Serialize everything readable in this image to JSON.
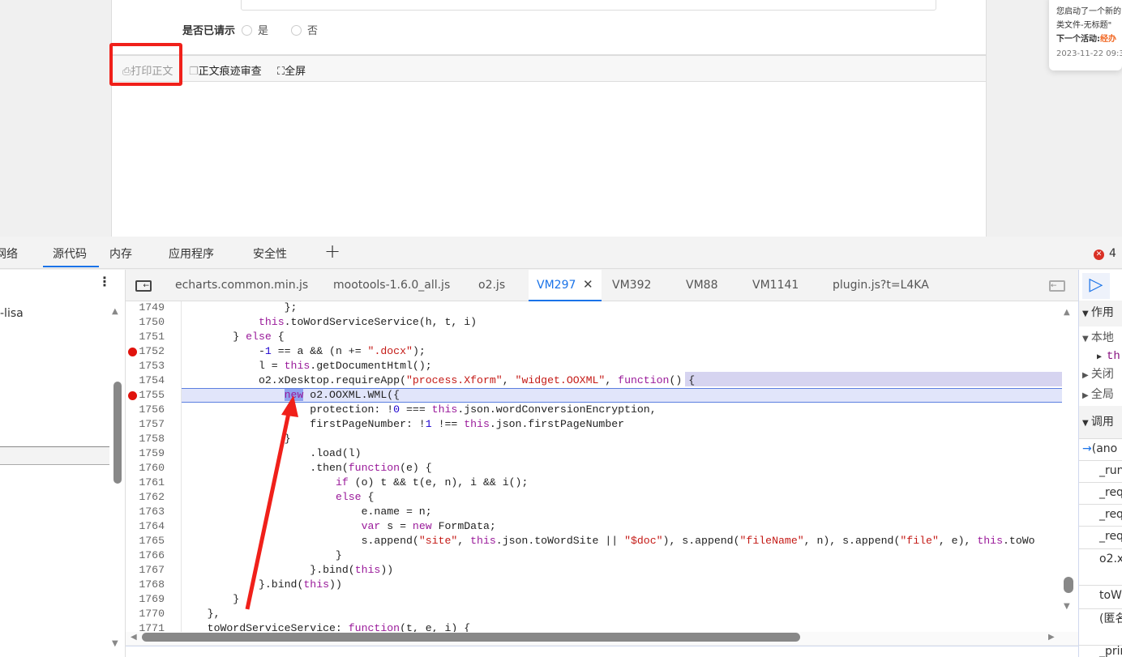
{
  "form": {
    "label": "是否已请示",
    "options": [
      "是",
      "否"
    ]
  },
  "toolbar": {
    "print": "打印正文",
    "revision": "正文痕迹审查",
    "fullscreen": "全屏"
  },
  "notification": {
    "line1": "您启动了一个新的",
    "line2": "类文件-无标题\"",
    "next_label": "下一个活动:",
    "next_value": "经办",
    "time": "2023-11-22 09:3"
  },
  "devtools": {
    "tabs": [
      "网络",
      "源代码",
      "内存",
      "应用程序",
      "安全性"
    ],
    "active_tab": "源代码",
    "add_tab": "+",
    "error_count": "4",
    "navigator_item": "-lisa",
    "file_tabs": [
      "echarts.common.min.js",
      "mootools-1.6.0_all.js",
      "o2.js",
      "VM297",
      "VM392",
      "VM88",
      "VM1141",
      "plugin.js?t=L4KA"
    ],
    "active_file": "VM297",
    "right_panel": {
      "scope": "作用",
      "local": "本地",
      "this": "th",
      "closure": "关闭",
      "global": "全局",
      "callstack": "调用",
      "frames": [
        "(ano",
        "_run",
        "_req",
        "_req",
        "_req",
        "o2.xl",
        "toWo",
        "(匿名",
        "_prin"
      ]
    }
  },
  "code": {
    "lines": [
      {
        "no": "1749",
        "t": [
          [
            "p",
            "                };"
          ]
        ]
      },
      {
        "no": "1750",
        "t": [
          [
            "p",
            "            "
          ],
          [
            "k",
            "this"
          ],
          [
            "p",
            ".toWordServiceService(h, t, i)"
          ]
        ]
      },
      {
        "no": "1751",
        "t": [
          [
            "p",
            "        } "
          ],
          [
            "k",
            "else"
          ],
          [
            "p",
            " {"
          ]
        ]
      },
      {
        "no": "1752",
        "bp": true,
        "t": [
          [
            "p",
            "            -"
          ],
          [
            "n",
            "1"
          ],
          [
            "p",
            " == a && (n += "
          ],
          [
            "s",
            "\".docx\""
          ],
          [
            "p",
            ");"
          ]
        ]
      },
      {
        "no": "1753",
        "t": [
          [
            "p",
            "            l = "
          ],
          [
            "k",
            "this"
          ],
          [
            "p",
            ".getDocumentHtml();"
          ]
        ]
      },
      {
        "no": "1754",
        "t": [
          [
            "p",
            "            o2.xDesktop.requireApp("
          ],
          [
            "s",
            "\"process.Xform\""
          ],
          [
            "p",
            ", "
          ],
          [
            "s",
            "\"widget.OOXML\""
          ],
          [
            "p",
            ", "
          ],
          [
            "k",
            "function"
          ],
          [
            "p",
            "() {"
          ]
        ]
      },
      {
        "no": "1755",
        "bp": true,
        "current": true,
        "t": [
          [
            "p",
            "                "
          ],
          [
            "k",
            "new"
          ],
          [
            "p",
            " o2.OOXML.WML({"
          ]
        ]
      },
      {
        "no": "1756",
        "t": [
          [
            "p",
            "                    protection: !"
          ],
          [
            "n",
            "0"
          ],
          [
            "p",
            " === "
          ],
          [
            "k",
            "this"
          ],
          [
            "p",
            ".json.wordConversionEncryption,"
          ]
        ]
      },
      {
        "no": "1757",
        "t": [
          [
            "p",
            "                    firstPageNumber: !"
          ],
          [
            "n",
            "1"
          ],
          [
            "p",
            " !== "
          ],
          [
            "k",
            "this"
          ],
          [
            "p",
            ".json.firstPageNumber"
          ]
        ]
      },
      {
        "no": "1758",
        "t": [
          [
            "p",
            "                }"
          ]
        ]
      },
      {
        "no": "1759",
        "t": [
          [
            "p",
            "                    .load(l)"
          ]
        ]
      },
      {
        "no": "1760",
        "t": [
          [
            "p",
            "                    .then("
          ],
          [
            "k",
            "function"
          ],
          [
            "p",
            "(e) {"
          ]
        ]
      },
      {
        "no": "1761",
        "t": [
          [
            "p",
            "                        "
          ],
          [
            "k",
            "if"
          ],
          [
            "p",
            " (o) t && t(e, n), i && i();"
          ]
        ]
      },
      {
        "no": "1762",
        "t": [
          [
            "p",
            "                        "
          ],
          [
            "k",
            "else"
          ],
          [
            "p",
            " {"
          ]
        ]
      },
      {
        "no": "1763",
        "t": [
          [
            "p",
            "                            e.name = n;"
          ]
        ]
      },
      {
        "no": "1764",
        "t": [
          [
            "p",
            "                            "
          ],
          [
            "k",
            "var"
          ],
          [
            "p",
            " s = "
          ],
          [
            "k",
            "new"
          ],
          [
            "p",
            " FormData;"
          ]
        ]
      },
      {
        "no": "1765",
        "t": [
          [
            "p",
            "                            s.append("
          ],
          [
            "s",
            "\"site\""
          ],
          [
            "p",
            ", "
          ],
          [
            "k",
            "this"
          ],
          [
            "p",
            ".json.toWordSite || "
          ],
          [
            "s",
            "\"$doc\""
          ],
          [
            "p",
            "), s.append("
          ],
          [
            "s",
            "\"fileName\""
          ],
          [
            "p",
            ", n), s.append("
          ],
          [
            "s",
            "\"file\""
          ],
          [
            "p",
            ", e), "
          ],
          [
            "k",
            "this"
          ],
          [
            "p",
            ".toWo"
          ]
        ]
      },
      {
        "no": "1766",
        "t": [
          [
            "p",
            "                        }"
          ]
        ]
      },
      {
        "no": "1767",
        "t": [
          [
            "p",
            "                    }.bind("
          ],
          [
            "k",
            "this"
          ],
          [
            "p",
            "))"
          ]
        ]
      },
      {
        "no": "1768",
        "t": [
          [
            "p",
            "            }.bind("
          ],
          [
            "k",
            "this"
          ],
          [
            "p",
            "))"
          ]
        ]
      },
      {
        "no": "1769",
        "t": [
          [
            "p",
            "        }"
          ]
        ]
      },
      {
        "no": "1770",
        "t": [
          [
            "p",
            "    },"
          ]
        ]
      },
      {
        "no": "1771",
        "t": [
          [
            "p",
            "    toWordServiceService: "
          ],
          [
            "k",
            "function"
          ],
          [
            "p",
            "(t, e, i) {"
          ]
        ]
      }
    ]
  }
}
